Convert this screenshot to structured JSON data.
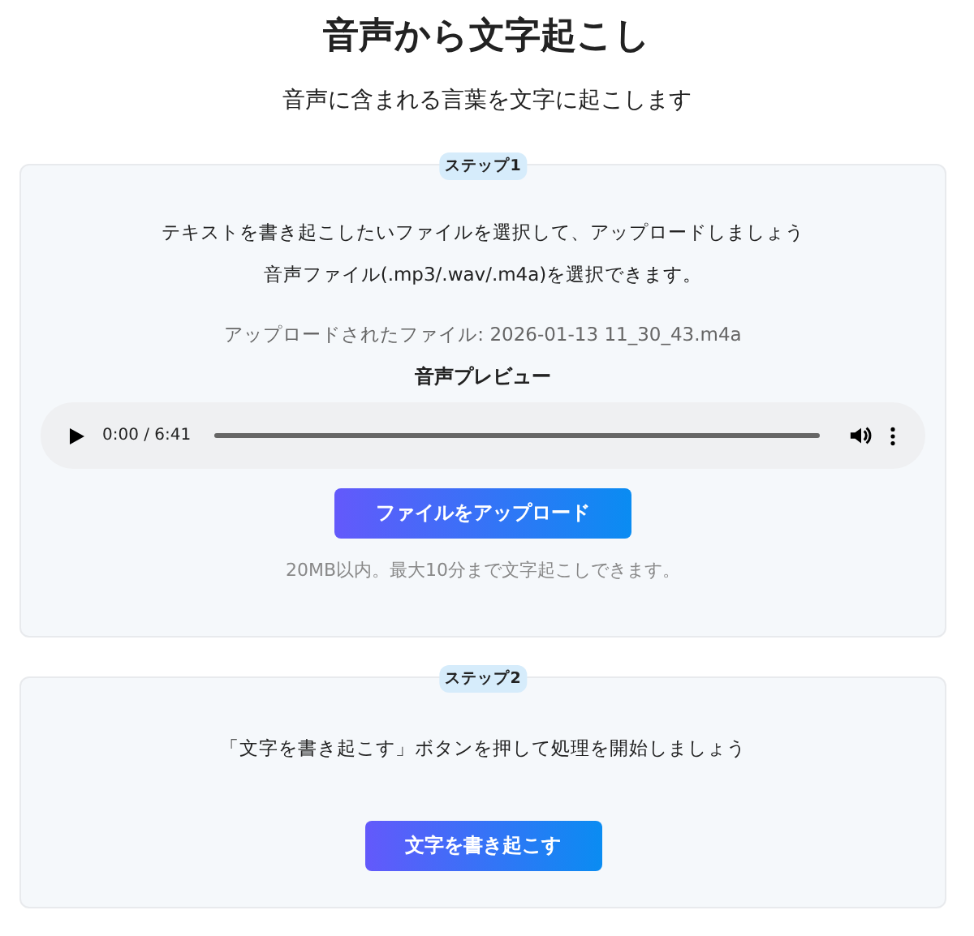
{
  "title": "音声から文字起こし",
  "subtitle": "音声に含まれる言葉を文字に起こします",
  "step1": {
    "badge": "ステップ1",
    "instructions": [
      "テキストを書き起こしたいファイルを選択して、アップロードしましょう",
      "音声ファイル(.mp3/.wav/.m4a)を選択できます。"
    ],
    "uploaded_file": "アップロードされたファイル: 2026-01-13 11_30_43.m4a",
    "preview_heading": "音声プレビュー",
    "player": {
      "time": "0:00 / 6:41"
    },
    "button": "ファイルをアップロード",
    "note": "20MB以内。最大10分まで文字起こしできます。"
  },
  "step2": {
    "badge": "ステップ2",
    "instruction": "「文字を書き起こす」ボタンを押して処理を開始しましょう",
    "button": "文字を書き起こす"
  }
}
